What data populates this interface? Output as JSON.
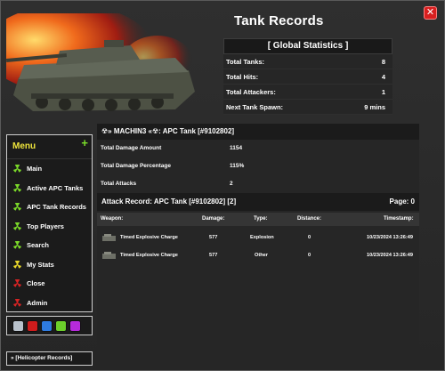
{
  "window": {
    "title": "Tank Records",
    "close_label": "✕"
  },
  "global": {
    "heading": "[ Global Statistics ]",
    "rows": [
      {
        "label": "Total Tanks:",
        "value": "8"
      },
      {
        "label": "Total Hits:",
        "value": "4"
      },
      {
        "label": "Total Attackers:",
        "value": "1"
      },
      {
        "label": "Next Tank Spawn:",
        "value": "9 mins"
      }
    ]
  },
  "menu": {
    "title": "Menu",
    "add_label": "+",
    "items": [
      {
        "label": "Main",
        "icon": "radiation-icon",
        "color": "#7bd829"
      },
      {
        "label": "Active APC Tanks",
        "icon": "radiation-icon",
        "color": "#7bd829"
      },
      {
        "label": "APC Tank Records",
        "icon": "radiation-icon",
        "color": "#7bd829"
      },
      {
        "label": "Top Players",
        "icon": "radiation-icon",
        "color": "#7bd829"
      },
      {
        "label": "Search",
        "icon": "radiation-icon",
        "color": "#7bd829"
      },
      {
        "label": "My Stats",
        "icon": "radiation-icon",
        "color": "#e8d62a"
      },
      {
        "label": "Close",
        "icon": "radiation-icon",
        "color": "#d62424"
      },
      {
        "label": "Admin",
        "icon": "radiation-icon",
        "color": "#d62424"
      }
    ]
  },
  "color_swatches": [
    "#b9c2cc",
    "#d01c1c",
    "#2e7be0",
    "#6ccf2b",
    "#b62adb"
  ],
  "helicopter_button": {
    "label": "» [Helicopter Records]"
  },
  "record": {
    "heading": "☢» MACHIN3 «☢: APC Tank [#9102802]",
    "rows": [
      {
        "label": "Total Damage Amount",
        "value": "1154"
      },
      {
        "label": "Total Damage Percentage",
        "value": "115%"
      },
      {
        "label": "Total Attacks",
        "value": "2"
      }
    ]
  },
  "attack": {
    "heading": "Attack Record: APC Tank [#9102802] [2]",
    "page": "Page: 0",
    "columns": {
      "weapon": "Weapon:",
      "damage": "Damage:",
      "type": "Type:",
      "distance": "Distance:",
      "timestamp": "Timestamp:"
    },
    "rows": [
      {
        "weapon": "Timed Explosive Charge",
        "damage": "577",
        "type": "Explosion",
        "distance": "0",
        "timestamp": "10/23/2024 13:26:49"
      },
      {
        "weapon": "Timed Explosive Charge",
        "damage": "577",
        "type": "Other",
        "distance": "0",
        "timestamp": "10/23/2024 13:26:49"
      }
    ]
  }
}
